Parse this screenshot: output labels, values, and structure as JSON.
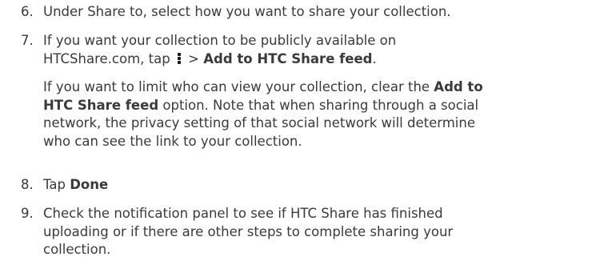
{
  "steps": [
    {
      "number": "6.",
      "lines": [
        "Under Share to, select how you want to share your collection."
      ]
    },
    {
      "number": "7.",
      "line1": "If you want your collection to be publicly available on",
      "line2_pre": "HTCShare.com, tap",
      "line2_sep": " > ",
      "line2_bold": "Add to HTC Share feed",
      "line2_post": ".",
      "note": {
        "l1_pre": "If you want to limit who can view your collection, clear the ",
        "l1_bold": "Add to",
        "l2_bold": "HTC Share feed",
        "l2_post": " option. Note that when sharing through a social",
        "l3": "network, the privacy setting of that social network will determine",
        "l4": "who can see the link to your collection."
      }
    },
    {
      "number": "8.",
      "pre": "Tap ",
      "bold": "Done"
    },
    {
      "number": "9.",
      "lines": [
        "Check the notification panel to see if HTC Share has finished",
        "uploading or if there are other steps to complete sharing your",
        "collection."
      ]
    }
  ]
}
